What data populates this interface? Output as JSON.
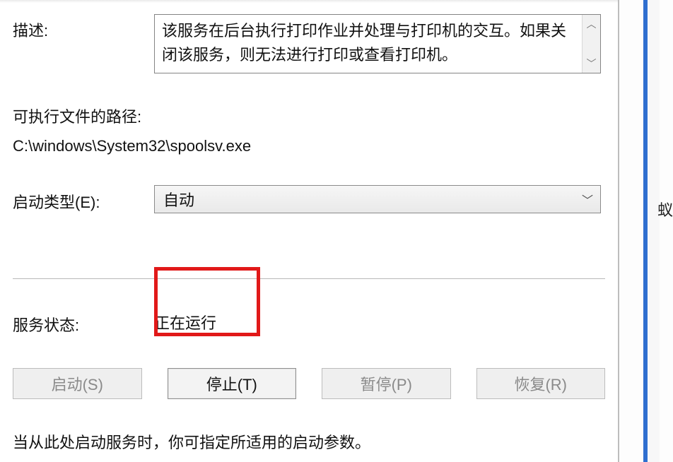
{
  "labels": {
    "description": "描述:",
    "exe_path_label": "可执行文件的路径:",
    "startup_type": "启动类型(E):",
    "service_status": "服务状态:",
    "hint": "当从此处启动服务时，你可指定所适用的启动参数。"
  },
  "description_text": "该服务在后台执行打印作业并处理与打印机的交互。如果关闭该服务，则无法进行打印或查看打印机。",
  "exe_path_value": "C:\\windows\\System32\\spoolsv.exe",
  "startup_type_value": "自动",
  "service_status_value": "正在运行",
  "buttons": {
    "start": "启动(S)",
    "stop": "停止(T)",
    "pause": "暂停(P)",
    "resume": "恢复(R)"
  },
  "side_char": "蚁"
}
